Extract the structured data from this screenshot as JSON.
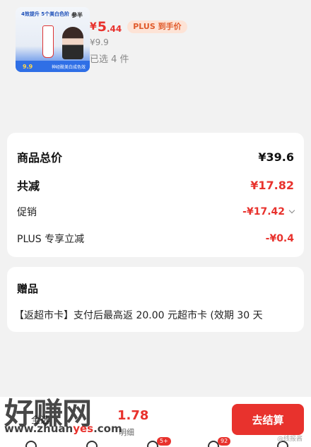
{
  "product": {
    "thumbnail": {
      "badge": "4效提升 5个美白色阶",
      "brand": "参半",
      "promo_price": "9.9",
      "promo_text": "神经酰美白成色效"
    },
    "price_symbol": "¥",
    "price_int": "5",
    "price_dec": ".44",
    "plus_badge": "PLUS 到手价",
    "original_price": "¥9.9",
    "selected_count": "已选 4 件"
  },
  "summary": {
    "total_label": "商品总价",
    "total_value": "¥39.6",
    "discount_label": "共减",
    "discount_value": "¥17.82",
    "promo_label": "促销",
    "promo_value": "-¥17.42",
    "plus_label": "PLUS 专享立减",
    "plus_value": "-¥0.4"
  },
  "gift": {
    "title": "赠品",
    "line": "【返超市卡】支付后最高返 20.00 元超市卡 (效期 30 天"
  },
  "bottom_bar": {
    "select_all": "全选",
    "total_amount": "1.78",
    "detail_link": "明细",
    "checkout": "去结算"
  },
  "nav": {
    "badge_messages": "5+",
    "badge_cart": "92"
  },
  "watermark": {
    "site_name": "好赚网",
    "url_prefix": "www.zhuan",
    "url_yes": "yes",
    "url_suffix": ".com",
    "weibo_tag": "@线报酱"
  },
  "colors": {
    "accent_red": "#e8322d",
    "background": "#f2f2f2"
  }
}
